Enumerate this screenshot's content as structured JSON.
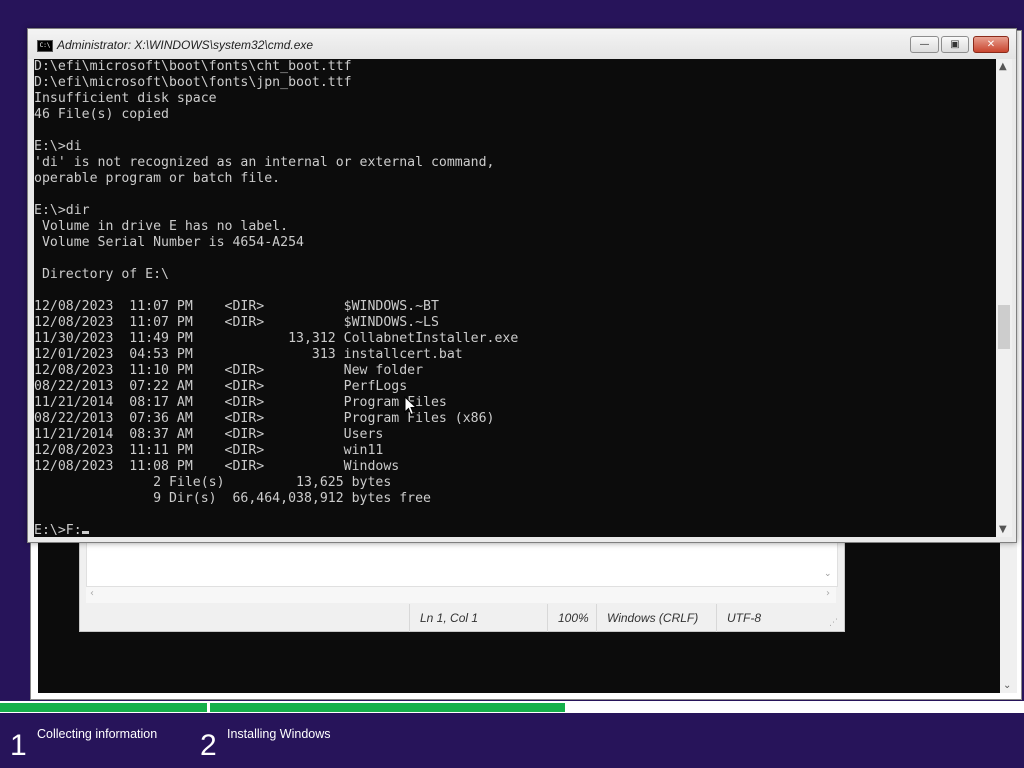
{
  "cmd_window": {
    "title": "Administrator: X:\\WINDOWS\\system32\\cmd.exe",
    "icon_text": "C:\\",
    "minimize_symbol": "—",
    "maximize_symbol": "▣",
    "close_symbol": "✕",
    "console_lines": [
      "D:\\efi\\microsoft\\boot\\fonts\\cht_boot.ttf",
      "D:\\efi\\microsoft\\boot\\fonts\\jpn_boot.ttf",
      "Insufficient disk space",
      "46 File(s) copied",
      "",
      "E:\\>di",
      "'di' is not recognized as an internal or external command,",
      "operable program or batch file.",
      "",
      "E:\\>dir",
      " Volume in drive E has no label.",
      " Volume Serial Number is 4654-A254",
      "",
      " Directory of E:\\",
      "",
      "12/08/2023  11:07 PM    <DIR>          $WINDOWS.~BT",
      "12/08/2023  11:07 PM    <DIR>          $WINDOWS.~LS",
      "11/30/2023  11:49 PM            13,312 CollabnetInstaller.exe",
      "12/01/2023  04:53 PM               313 installcert.bat",
      "12/08/2023  11:10 PM    <DIR>          New folder",
      "08/22/2013  07:22 AM    <DIR>          PerfLogs",
      "11/21/2014  08:17 AM    <DIR>          Program Files",
      "08/22/2013  07:36 AM    <DIR>          Program Files (x86)",
      "11/21/2014  08:37 AM    <DIR>          Users",
      "12/08/2023  11:11 PM    <DIR>          win11",
      "12/08/2023  11:08 PM    <DIR>          Windows",
      "               2 File(s)         13,625 bytes",
      "               9 Dir(s)  66,464,038,912 bytes free",
      ""
    ],
    "prompt": "E:\\>F:",
    "scroll_up": "▲",
    "scroll_down": "▼"
  },
  "notepad": {
    "status": {
      "position": "Ln 1, Col 1",
      "zoom": "100%",
      "line_endings": "Windows (CRLF)",
      "encoding": "UTF-8"
    },
    "scroll_left": "‹",
    "scroll_right": "›",
    "scroll_down": "⌄",
    "grip": "⋰"
  },
  "setup": {
    "scroll_down": "⌄",
    "steps": [
      {
        "number": "1",
        "label": "Collecting information"
      },
      {
        "number": "2",
        "label": "Installing Windows"
      }
    ],
    "progress_color": "#16b04a",
    "background_color": "#27145a"
  }
}
